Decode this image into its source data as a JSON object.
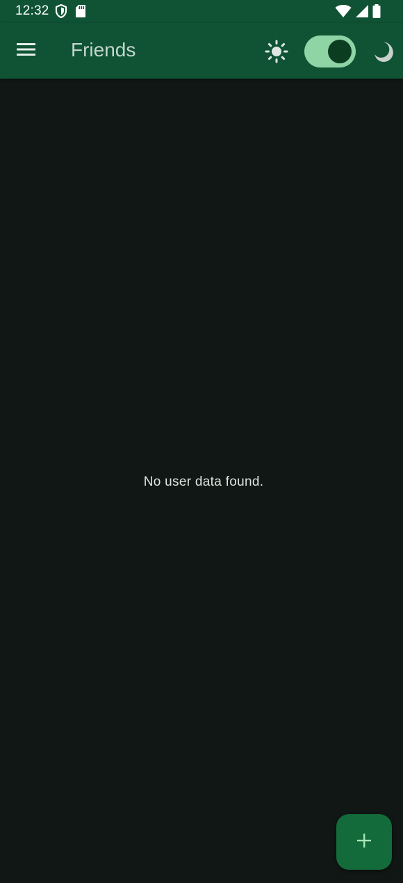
{
  "status_bar": {
    "time": "12:32",
    "icons": [
      "shield-icon",
      "sd-card-icon",
      "wifi-icon",
      "cell-signal-icon",
      "battery-icon"
    ]
  },
  "app_bar": {
    "title": "Friends",
    "menu_icon": "hamburger-menu-icon",
    "light_icon": "sun-icon",
    "dark_icon": "moon-icon",
    "dark_mode_enabled": true
  },
  "main": {
    "empty_message": "No user data found."
  },
  "fab": {
    "icon": "plus-icon"
  },
  "colors": {
    "background": "#101714",
    "app_bar": "#0f5334",
    "toggle_track": "#8fd4a4",
    "toggle_thumb": "#0b3d21",
    "fab": "#136a3a",
    "fab_icon": "#a8e6b8"
  }
}
